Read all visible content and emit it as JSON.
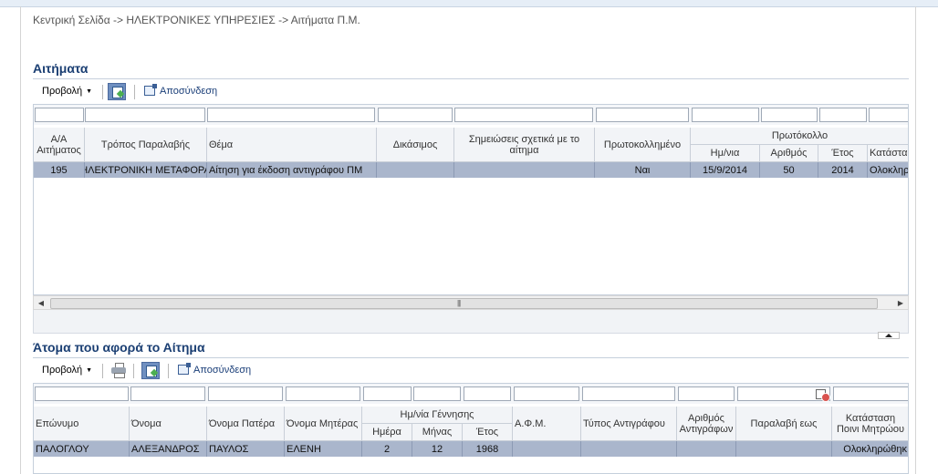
{
  "breadcrumb": "Κεντρική Σελίδα -> ΗΛΕΚΤΡΟΝΙΚΕΣ ΥΠΗΡΕΣΙΕΣ -> Αιτήματα Π.Μ.",
  "requests": {
    "title": "Αιτήματα",
    "toolbar": {
      "view_label": "Προβολή",
      "detach_label": "Αποσύνδεση"
    },
    "columns": {
      "aa": "Α/Α Αιτήματος",
      "method": "Τρόπος Παραλαβής",
      "subject": "Θέμα",
      "fee": "Δικάσιμος",
      "notes": "Σημειώσεις σχετικά με το αίτημα",
      "registered": "Πρωτοκολλημένο",
      "protocol": "Πρωτόκολλο",
      "proto_date": "Ημ/νια",
      "proto_number": "Αριθμός",
      "proto_year": "Έτος",
      "status": "Κατάστασ"
    },
    "row": {
      "aa": "195",
      "method": "ΗΛΕΚΤΡΟΝΙΚΗ ΜΕΤΑΦΟΡΑ",
      "subject": "Αίτηση για έκδοση αντιγράφου ΠΜ",
      "fee": "",
      "notes": "",
      "registered": "Ναι",
      "proto_date": "15/9/2014",
      "proto_number": "50",
      "proto_year": "2014",
      "status": "Ολοκληρ"
    }
  },
  "persons": {
    "title": "Άτομα που αφορά το Αίτημα",
    "toolbar": {
      "view_label": "Προβολή",
      "detach_label": "Αποσύνδεση"
    },
    "columns": {
      "surname": "Επώνυμο",
      "name": "Όνομα",
      "father": "Όνομα Πατέρα",
      "mother": "Όνομα Μητέρας",
      "birth": "Ημ/νία Γέννησης",
      "day": "Ημέρα",
      "month": "Μήνας",
      "year": "Έτος",
      "afm": "Α.Φ.Μ.",
      "copy_type": "Τύπος Αντιγράφου",
      "copy_count": "Αριθμός Αντιγράφων",
      "received_until": "Παραλαβή εως",
      "record_status": "Κατάσταση Ποινι Μητρώου"
    },
    "row": {
      "surname": "ΠΑΛΟΓΛΟΥ",
      "name": "ΑΛΕΞΑΝΔΡΟΣ",
      "father": "ΠΑΥΛΟΣ",
      "mother": "ΕΛΕΝΗ",
      "day": "2",
      "month": "12",
      "year": "1968",
      "afm": "",
      "copy_type": "",
      "copy_count": "",
      "received_until": "",
      "record_status": "Ολοκληρώθηκ"
    }
  }
}
